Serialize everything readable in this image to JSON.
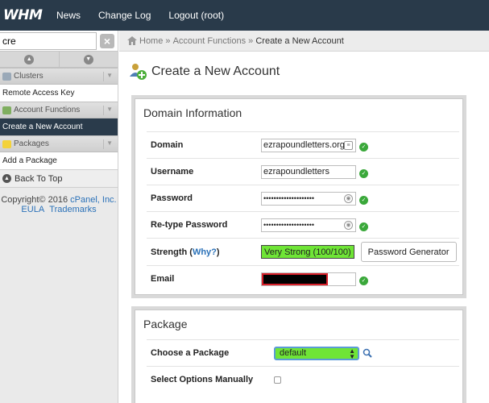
{
  "topbar": {
    "logo": "WHM",
    "nav": [
      {
        "label": "News"
      },
      {
        "label": "Change Log"
      },
      {
        "label": "Logout (root)"
      }
    ]
  },
  "sidebar": {
    "search_value": "cre",
    "clear_label": "×",
    "groups": [
      {
        "label": "Clusters",
        "items": [
          "Remote Access Key"
        ]
      },
      {
        "label": "Account Functions",
        "items": [
          "Create a New Account"
        ]
      },
      {
        "label": "Packages",
        "items": [
          "Add a Package"
        ]
      }
    ],
    "back_to_top": "Back To Top",
    "copyright": "Copyright© 2016",
    "company": "cPanel, Inc.",
    "eula": "EULA",
    "trademarks": "Trademarks"
  },
  "breadcrumb": {
    "home": "Home",
    "sep": "»",
    "section": "Account Functions",
    "current": "Create a New Account"
  },
  "page": {
    "title": "Create a New Account"
  },
  "domain_panel": {
    "title": "Domain Information",
    "domain_label": "Domain",
    "domain_value": "ezrapoundletters.org",
    "username_label": "Username",
    "username_value": "ezrapoundletters",
    "password_label": "Password",
    "password_value": "••••••••••••••••••••",
    "retype_label": "Re-type Password",
    "retype_value": "••••••••••••••••••••",
    "strength_label": "Strength (",
    "strength_why": "Why?",
    "strength_close": ")",
    "strength_value": "Very Strong (100/100)",
    "pw_gen_label": "Password Generator",
    "email_label": "Email"
  },
  "package_panel": {
    "title": "Package",
    "choose_label": "Choose a Package",
    "choose_value": "default",
    "manual_label": "Select Options Manually"
  },
  "colors": {
    "topbar": "#293a4a",
    "active_item": "#2a3b4b",
    "strength_bg": "#6fe536",
    "check": "#3aa83a",
    "link": "#2a71b8"
  }
}
